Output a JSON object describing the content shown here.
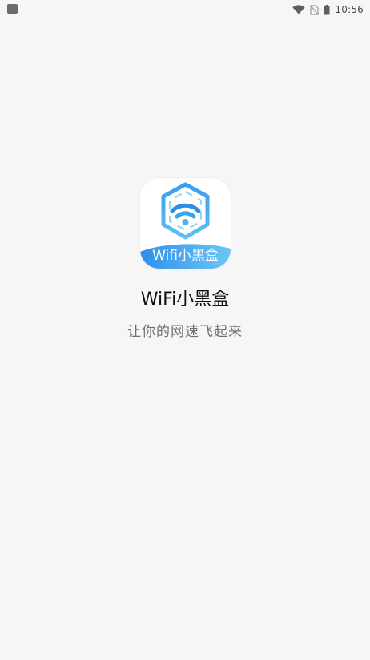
{
  "status_bar": {
    "time": "10:56",
    "icons": [
      "notification-icon",
      "wifi-icon",
      "no-sim-icon",
      "battery-icon"
    ]
  },
  "splash": {
    "app_icon_text": "Wifi小黑盒",
    "app_name": "WiFi小黑盒",
    "slogan": "让你的网速飞起来"
  },
  "colors": {
    "background": "#f6f6f6",
    "brand_blue": "#3aa3f0",
    "brand_blue_light": "#6cc6f7"
  }
}
